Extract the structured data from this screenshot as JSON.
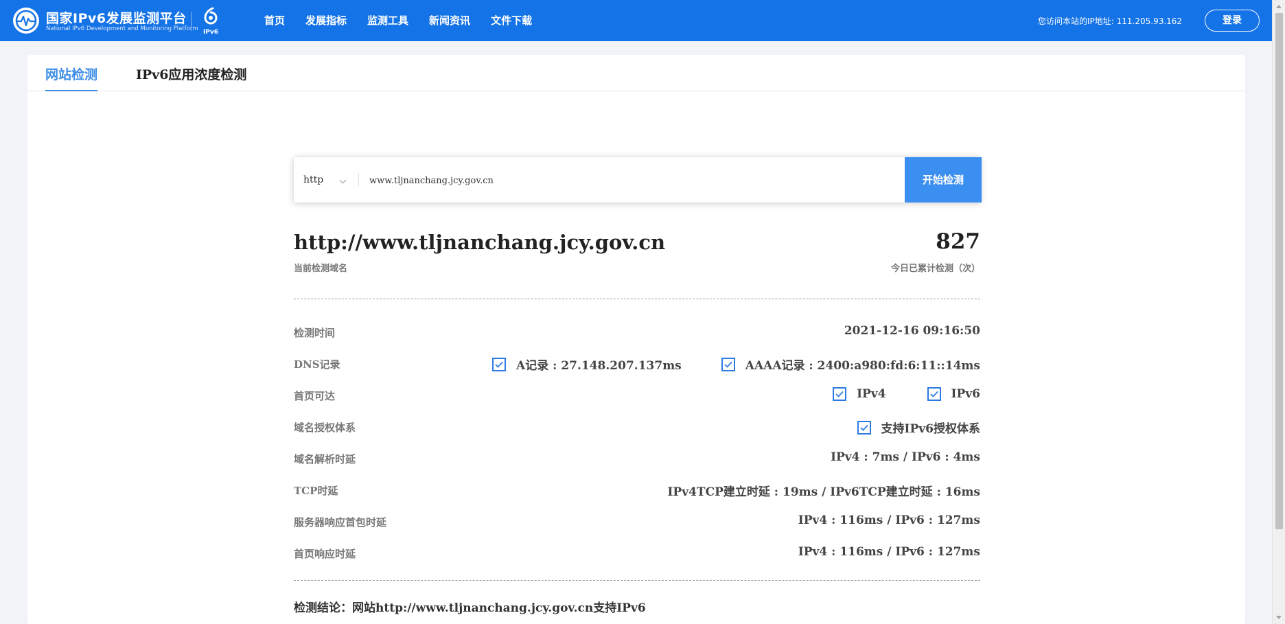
{
  "header": {
    "logo_title": "国家IPv6发展监测平台",
    "logo_subtitle": "National IPv6 Development and Monitoring Platform",
    "logo_icon": "globe-pulse-logo",
    "ipv6_mark_label": "IPv6",
    "nav": [
      "首页",
      "发展指标",
      "监测工具",
      "新闻资讯",
      "文件下载"
    ],
    "ip_note": "您访问本站的IP地址: 111.205.93.162",
    "login_label": "登录",
    "bg_color": "#1473e6"
  },
  "tabs": [
    {
      "label": "网站检测",
      "active": true
    },
    {
      "label": "IPv6应用浓度检测",
      "active": false
    }
  ],
  "search": {
    "protocol": "http",
    "url_value": "www.tljnanchang.jcy.gov.cn",
    "start_label": "开始检测",
    "accent_color": "#3b8ff0"
  },
  "summary": {
    "domain": "http://www.tljnanchang.jcy.gov.cn",
    "domain_label": "当前检测域名",
    "count": "827",
    "count_label": "今日已累计检测（次）"
  },
  "results": {
    "time": {
      "label": "检测时间",
      "value": "2021-12-16 09:16:50"
    },
    "dns": {
      "label": "DNS记录",
      "a_record": "A记录 : 27.148.207.137ms",
      "aaaa_record": "AAAA记录 : 2400:a980:fd:6:11::14ms"
    },
    "reach": {
      "label": "首页可达",
      "ipv4": "IPv4",
      "ipv6": "IPv6"
    },
    "auth": {
      "label": "域名授权体系",
      "value": "支持IPv6授权体系"
    },
    "dns_latency": {
      "label": "域名解析时延",
      "value": "IPv4 : 7ms / IPv6 : 4ms"
    },
    "tcp": {
      "label": "TCP时延",
      "value": "IPv4TCP建立时延 : 19ms / IPv6TCP建立时延 : 16ms"
    },
    "first_packet": {
      "label": "服务器响应首包时延",
      "value": "IPv4 : 116ms / IPv6 : 127ms"
    },
    "page_response": {
      "label": "首页响应时延",
      "value": "IPv4 : 116ms / IPv6 : 127ms"
    }
  },
  "conclusion": "检测结论：网站http://www.tljnanchang.jcy.gov.cn支持IPv6"
}
